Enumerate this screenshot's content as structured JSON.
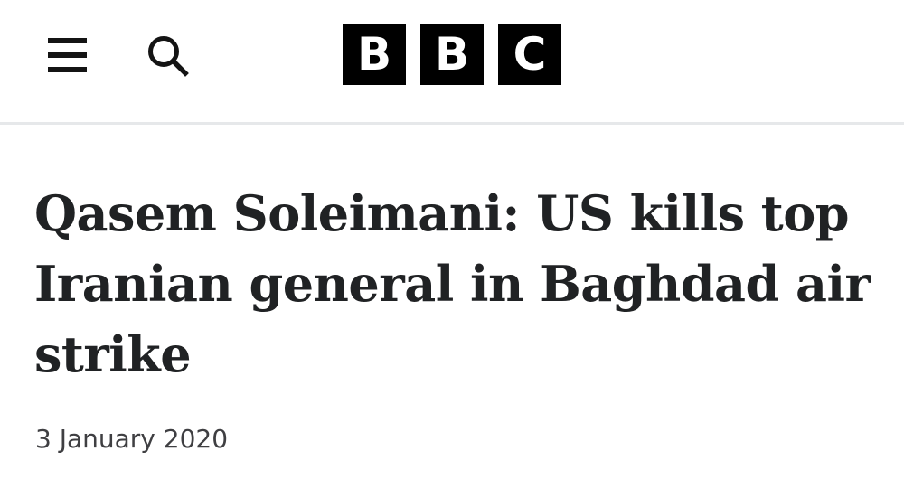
{
  "header": {
    "menu_icon": "hamburger-menu-icon",
    "search_icon": "search-icon",
    "logo": {
      "letters": [
        "B",
        "B",
        "C"
      ],
      "background": "#000000",
      "foreground": "#ffffff"
    }
  },
  "article": {
    "headline": "Qasem Soleimani: US kills top Iranian general in Baghdad air strike",
    "date": "3 January 2020"
  }
}
